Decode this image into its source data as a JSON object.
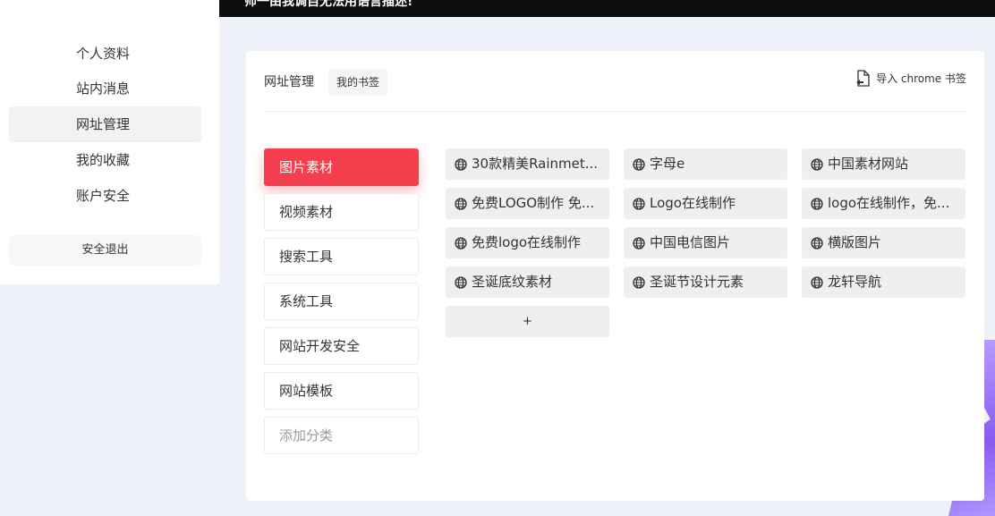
{
  "banner": {
    "text": "师一由我调自无法用语言描述!"
  },
  "sidebar": {
    "items": [
      {
        "label": "个人资料",
        "active": false
      },
      {
        "label": "站内消息",
        "active": false
      },
      {
        "label": "网址管理",
        "active": true
      },
      {
        "label": "我的收藏",
        "active": false
      },
      {
        "label": "账户安全",
        "active": false
      }
    ],
    "logout_label": "安全退出"
  },
  "panel": {
    "title": "网址管理",
    "tab_label": "我的书签",
    "import_label": "导入 chrome 书签"
  },
  "categories": [
    {
      "label": "图片素材",
      "active": true
    },
    {
      "label": "视频素材",
      "active": false
    },
    {
      "label": "搜索工具",
      "active": false
    },
    {
      "label": "系统工具",
      "active": false
    },
    {
      "label": "网站开发安全",
      "active": false
    },
    {
      "label": "网站模板",
      "active": false
    }
  ],
  "add_category_label": "添加分类",
  "links": [
    "30款精美Rainmet...",
    "字母e",
    "中国素材网站",
    "免费LOGO制作 免...",
    "Logo在线制作",
    "logo在线制作，免...",
    "免费logo在线制作",
    "中国电信图片",
    "横版图片",
    "圣诞底纹素材",
    "圣诞节设计元素",
    "龙轩导航"
  ],
  "add_link_label": "+",
  "icons": {
    "link_icon": "globe-icon",
    "import_icon": "file-import-icon"
  },
  "colors": {
    "accent": "#f43f4e",
    "chip_bg": "#efefef",
    "page_bg": "#eef1f7"
  }
}
